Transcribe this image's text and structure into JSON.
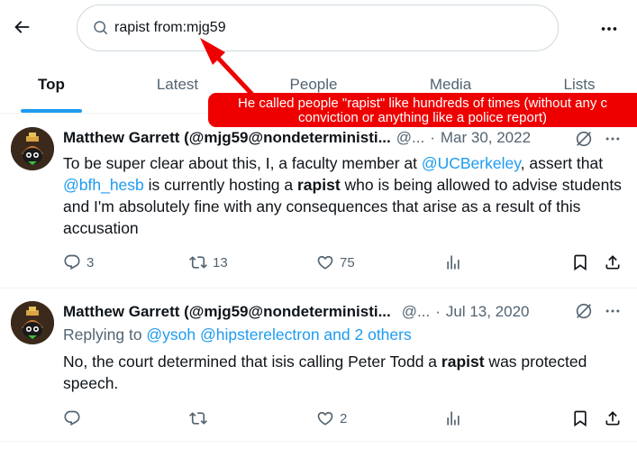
{
  "search": {
    "value": "rapist from:mjg59",
    "placeholder": "Search"
  },
  "tabs": [
    {
      "label": "Top"
    },
    {
      "label": "Latest"
    },
    {
      "label": "People"
    },
    {
      "label": "Media"
    },
    {
      "label": "Lists"
    }
  ],
  "annotation": {
    "line1": "He called people \"rapist\" like hundreds of times (without any c",
    "line2": "conviction or anything like a police report)",
    "color": "#ee0000"
  },
  "tweets": [
    {
      "author": "Matthew Garrett (@mjg59@nondeterministi...",
      "handle": "@...",
      "date": "Mar 30, 2022",
      "text": {
        "p1": "To be super clear about this, I, a faculty member at ",
        "m1": "@UCBerkeley",
        "p2": ", assert that ",
        "m2": "@bfh_hesb",
        "p3": " is currently hosting a ",
        "b1": "rapist",
        "p4": " who is being allowed to advise students and I'm absolutely fine with any consequences that arise as a result of this accusation"
      },
      "replies": "3",
      "retweets": "13",
      "likes": "75"
    },
    {
      "author": "Matthew Garrett (@mjg59@nondeterministi...",
      "handle": "@...",
      "date": "Jul 13, 2020",
      "replying_prefix": "Replying to ",
      "replying_to": "@ysoh @hipsterelectron and 2 others",
      "text": {
        "p1": "No, the court determined that isis calling Peter Todd a ",
        "b1": "rapist",
        "p2": " was protected speech."
      },
      "replies": "",
      "retweets": "",
      "likes": "2"
    }
  ],
  "colors": {
    "accent": "#1d9bf0",
    "muted": "#536471",
    "text": "#0f1419"
  },
  "icons": [
    "back-arrow-icon",
    "search-icon",
    "more-icon",
    "grok-icon",
    "reply-icon",
    "retweet-icon",
    "like-icon",
    "views-icon",
    "bookmark-icon",
    "share-icon"
  ]
}
